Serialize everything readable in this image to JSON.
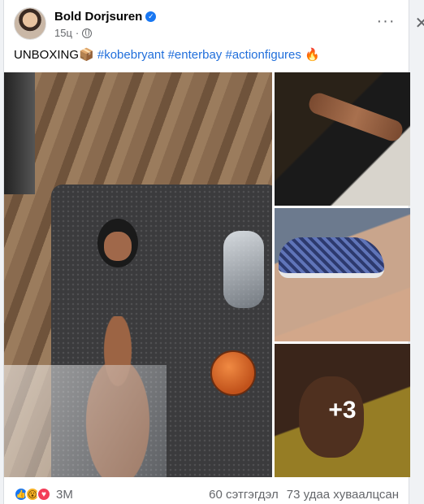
{
  "post": {
    "author": "Bold Dorjsuren",
    "time": "15ц",
    "text_prefix": "UNBOXING📦 ",
    "hashtags": [
      "#kobebryant",
      "#enterbay",
      "#actionfigures"
    ],
    "text_suffix": " 🔥",
    "more_count": "+3"
  },
  "footer": {
    "reactions_count": "3M",
    "comments": "60 сэтгэгдэл",
    "shares": "73 удаа хуваалцсан"
  },
  "icons": {
    "more": "more-horizontal-icon",
    "close": "close-icon",
    "privacy": "globe-icon",
    "verified": "verified-badge-icon",
    "reactions": [
      "like-icon",
      "wow-icon",
      "love-icon"
    ]
  }
}
